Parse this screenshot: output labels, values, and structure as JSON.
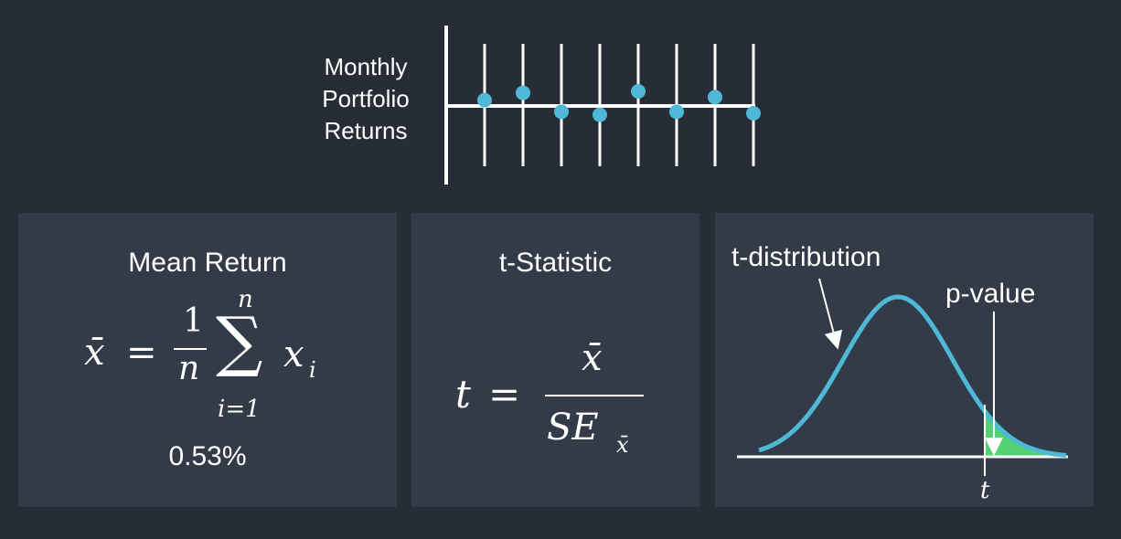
{
  "series_label": [
    "Monthly",
    "Portfolio",
    "Returns"
  ],
  "monthly_returns": [
    0.4,
    0.9,
    -0.4,
    -0.6,
    1.0,
    -0.4,
    0.6,
    -0.5
  ],
  "panels": {
    "mean": {
      "title": "Mean Return",
      "value": "0.53%",
      "formula": {
        "lhs": "x̄",
        "eq": "=",
        "frac_num": "1",
        "frac_den": "n",
        "sum_upper": "n",
        "sum_symbol": "∑",
        "sum_lower": "i=1",
        "term_base": "x",
        "term_sub": "i"
      }
    },
    "tstat": {
      "title": "t-Statistic",
      "formula": {
        "lhs": "t",
        "eq": "=",
        "num": "x̄",
        "den_base": "SE",
        "den_sub": "x̄"
      }
    },
    "dist": {
      "curve_label": "t-distribution",
      "area_label": "p-value",
      "axis_tick_label": "t"
    }
  },
  "colors": {
    "background": "#262d37",
    "panel": "#323b47",
    "curve": "#4fb8d6",
    "tail_fill": "#52d273",
    "dot": "#4fb8d6",
    "line": "#ffffff"
  }
}
